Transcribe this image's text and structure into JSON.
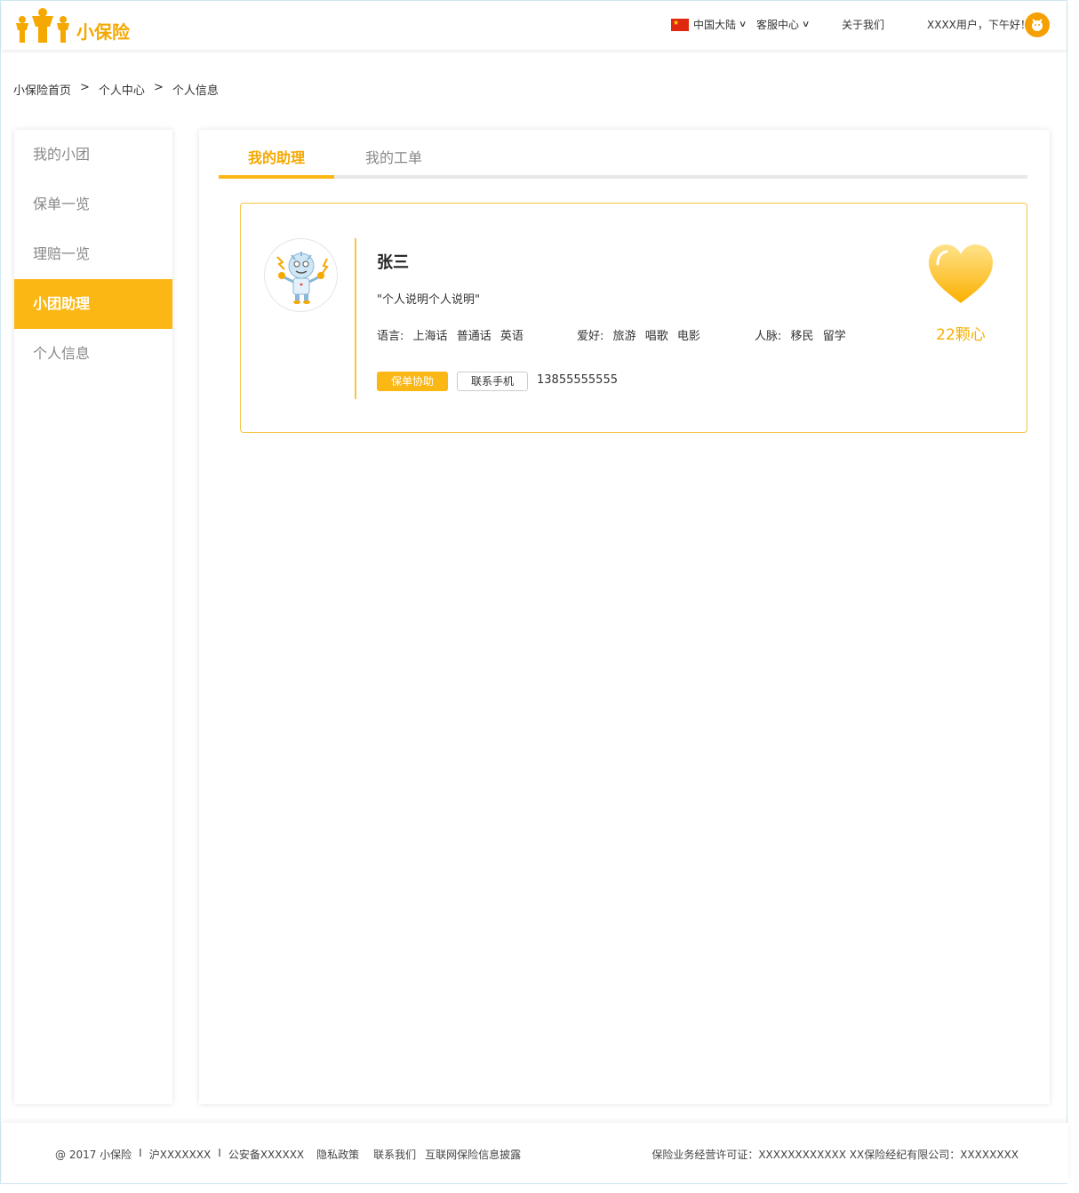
{
  "header": {
    "brand": "小保险",
    "region": "中国大陆",
    "service": "客服中心",
    "about": "关于我们",
    "greeting": "XXXX用户，下午好！"
  },
  "breadcrumb": {
    "home": "小保险首页",
    "sep1": ">",
    "center": "个人中心",
    "sep2": ">",
    "current": "个人信息"
  },
  "sidebar": {
    "items": [
      {
        "label": "我的小团"
      },
      {
        "label": "保单一览"
      },
      {
        "label": "理赔一览"
      },
      {
        "label": "小团助理"
      },
      {
        "label": "个人信息"
      }
    ],
    "active_index": 3
  },
  "tabs": [
    {
      "label": "我的助理"
    },
    {
      "label": "我的工单"
    }
  ],
  "assistant": {
    "name": "张三",
    "description": "\"个人说明个人说明\"",
    "language_label": "语言:",
    "languages": [
      "上海话",
      "普通话",
      "英语"
    ],
    "hobby_label": "爱好:",
    "hobbies": [
      "旅游",
      "唱歌",
      "电影"
    ],
    "network_label": "人脉:",
    "network": [
      "移民",
      "留学"
    ],
    "btn_assist": "保单协助",
    "btn_contact": "联系手机",
    "phone": "13855555555",
    "hearts": "22颗心"
  },
  "footer": {
    "copyright": "@ 2017 小保险",
    "sep": "I",
    "icp": "沪XXXXXXX",
    "police": "公安备XXXXXX",
    "privacy": "隐私政策",
    "contact": "联系我们",
    "disclosure": "互联网保险信息披露",
    "license": "保险业务经营许可证：XXXXXXXXXXXX XX保险经纪有限公司：XXXXXXXX"
  },
  "colors": {
    "accent": "#fbb713",
    "accent_text": "#f5a800",
    "border": "#f5c544"
  }
}
